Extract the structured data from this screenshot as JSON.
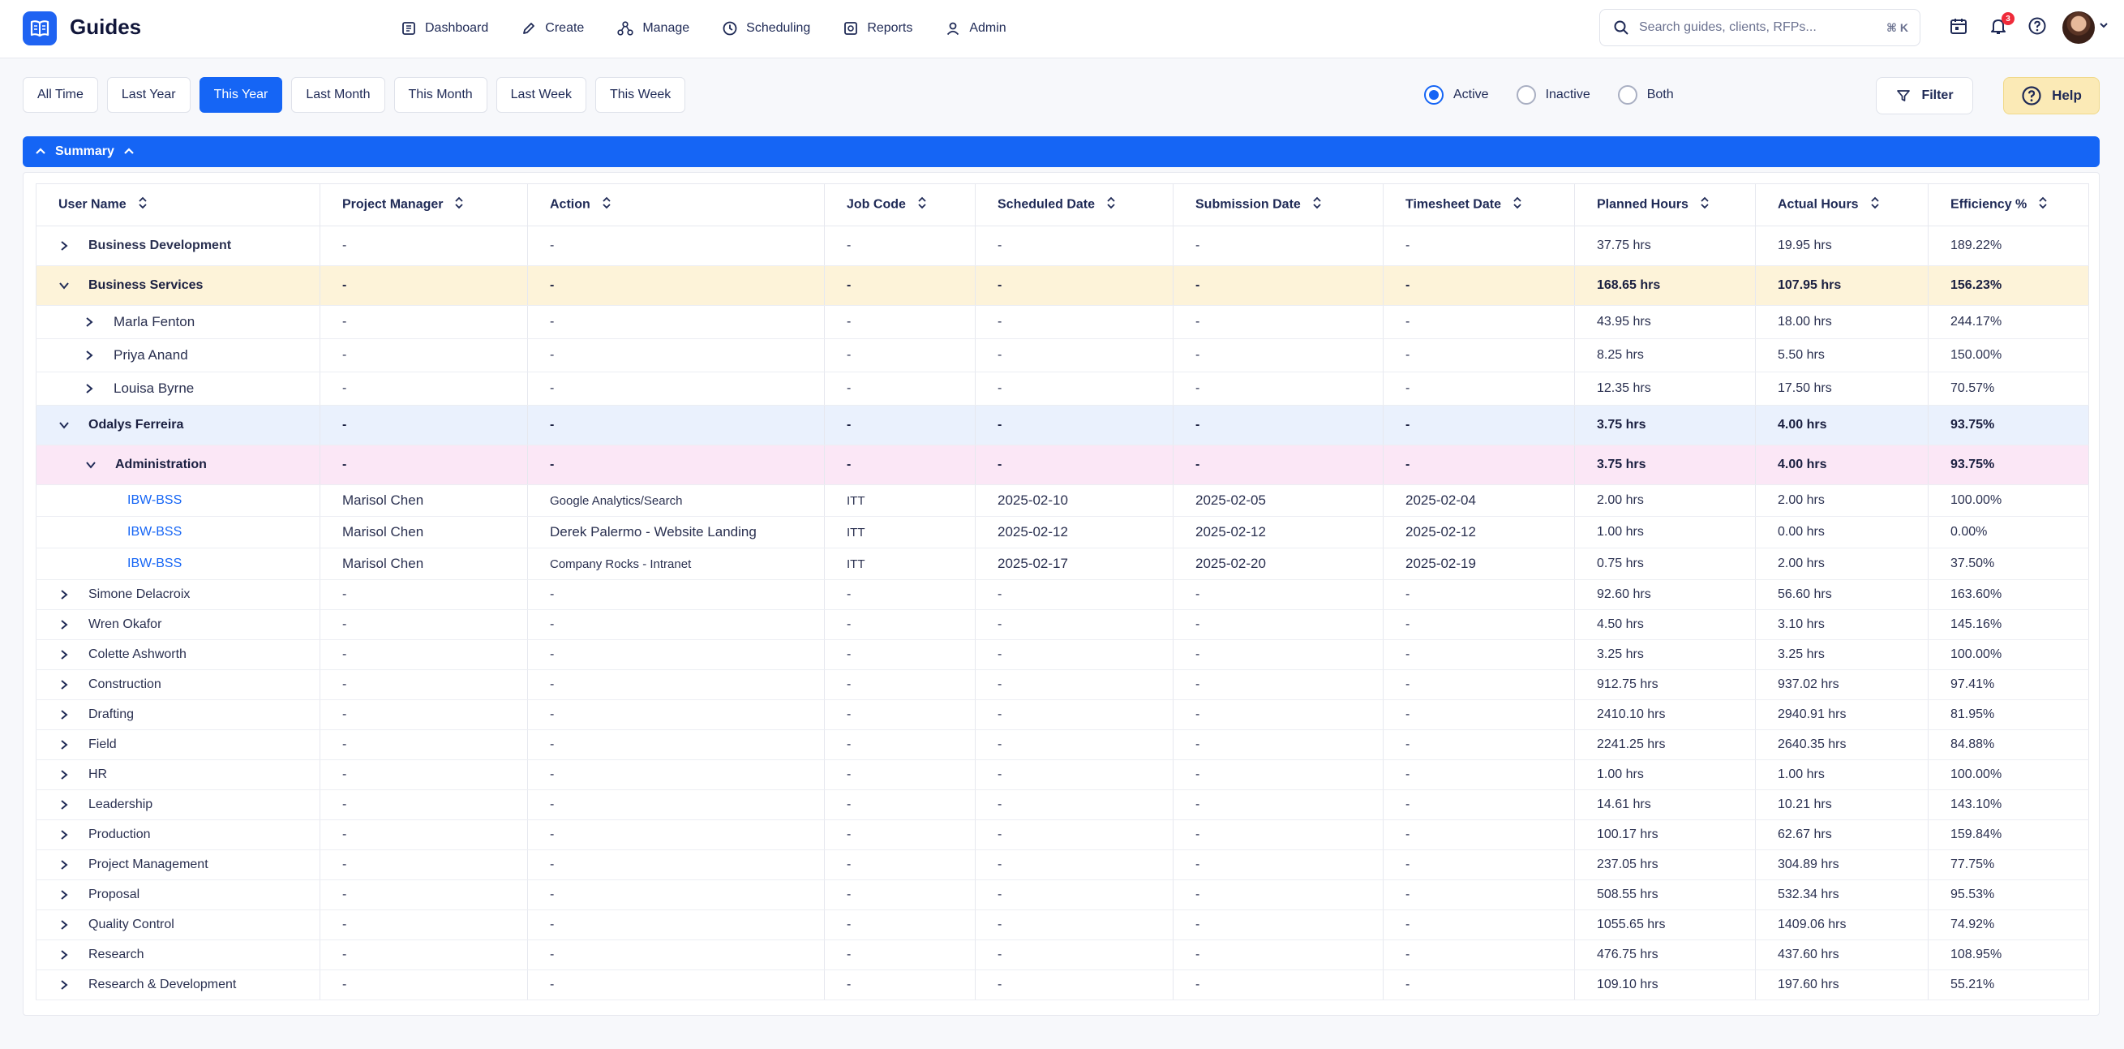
{
  "app": {
    "brand": "Guides"
  },
  "nav": [
    {
      "label": "Dashboard",
      "icon": "dashboard-icon"
    },
    {
      "label": "Create",
      "icon": "pencil-icon"
    },
    {
      "label": "Manage",
      "icon": "manage-icon"
    },
    {
      "label": "Scheduling",
      "icon": "clock-icon"
    },
    {
      "label": "Reports",
      "icon": "reports-icon"
    },
    {
      "label": "Admin",
      "icon": "user-icon"
    }
  ],
  "search": {
    "placeholder": "Search guides, clients, RFPs...",
    "shortcut": "⌘ K"
  },
  "notifications": {
    "count": "3"
  },
  "periods": [
    "All Time",
    "Last Year",
    "This Year",
    "Last Month",
    "This Month",
    "Last Week",
    "This Week"
  ],
  "selected_period": "This Year",
  "status_filter": {
    "options": [
      "Active",
      "Inactive",
      "Both"
    ],
    "selected": "Active"
  },
  "buttons": {
    "filter": "Filter",
    "help": "Help"
  },
  "summary": {
    "label": "Summary"
  },
  "table": {
    "columns": [
      "User Name",
      "Project Manager",
      "Action",
      "Job Code",
      "Scheduled Date",
      "Submission Date",
      "Timesheet Date",
      "Planned Hours",
      "Actual Hours",
      "Efficiency %"
    ],
    "rows": [
      {
        "name": "Business Development",
        "level": 0,
        "expanded": false,
        "kind": "group",
        "pm": "-",
        "action": "-",
        "job": "-",
        "sched": "-",
        "sub": "-",
        "ts": "-",
        "planned": "37.75 hrs",
        "actual": "19.95 hrs",
        "eff": "189.22%"
      },
      {
        "name": "Business Services",
        "level": 0,
        "expanded": true,
        "kind": "group",
        "bg": "yellow",
        "bold": true,
        "pm": "-",
        "action": "-",
        "job": "-",
        "sched": "-",
        "sub": "-",
        "ts": "-",
        "planned": "168.65 hrs",
        "actual": "107.95 hrs",
        "eff": "156.23%"
      },
      {
        "name": "Marla Fenton",
        "level": 1,
        "expanded": false,
        "kind": "sub",
        "pm": "-",
        "action": "-",
        "job": "-",
        "sched": "-",
        "sub": "-",
        "ts": "-",
        "planned": "43.95 hrs",
        "actual": "18.00 hrs",
        "eff": "244.17%"
      },
      {
        "name": "Priya Anand",
        "level": 1,
        "expanded": false,
        "kind": "sub",
        "pm": "-",
        "action": "-",
        "job": "-",
        "sched": "-",
        "sub": "-",
        "ts": "-",
        "planned": "8.25 hrs",
        "actual": "5.50 hrs",
        "eff": "150.00%"
      },
      {
        "name": "Louisa Byrne",
        "level": 1,
        "expanded": false,
        "kind": "sub",
        "pm": "-",
        "action": "-",
        "job": "-",
        "sched": "-",
        "sub": "-",
        "ts": "-",
        "planned": "12.35 hrs",
        "actual": "17.50 hrs",
        "eff": "70.57%"
      },
      {
        "name": "Odalys Ferreira",
        "level": 0,
        "expanded": true,
        "kind": "group",
        "bg": "blue",
        "bold": true,
        "pm": "-",
        "action": "-",
        "job": "-",
        "sched": "-",
        "sub": "-",
        "ts": "-",
        "planned": "3.75 hrs",
        "actual": "4.00 hrs",
        "eff": "93.75%"
      },
      {
        "name": "Administration",
        "level": 2,
        "expanded": true,
        "kind": "group",
        "bg": "pink",
        "bold": true,
        "pm": "-",
        "action": "-",
        "job": "-",
        "sched": "-",
        "sub": "-",
        "ts": "-",
        "planned": "3.75 hrs",
        "actual": "4.00 hrs",
        "eff": "93.75%"
      },
      {
        "name": "IBW-BSS",
        "level": 3,
        "kind": "detail",
        "link": true,
        "pm": "Marisol Chen",
        "action": "Google Analytics/Search",
        "job": "ITT",
        "sched": "2025-02-10",
        "sub": "2025-02-05",
        "ts": "2025-02-04",
        "planned": "2.00 hrs",
        "actual": "2.00 hrs",
        "eff": "100.00%"
      },
      {
        "name": "IBW-BSS",
        "level": 3,
        "kind": "detail",
        "link": true,
        "pm": "Marisol Chen",
        "action": "Derek Palermo - Website Landing",
        "job": "ITT",
        "sched": "2025-02-12",
        "sub": "2025-02-12",
        "ts": "2025-02-12",
        "planned": "1.00 hrs",
        "actual": "0.00 hrs",
        "eff": "0.00%"
      },
      {
        "name": "IBW-BSS",
        "level": 3,
        "kind": "detail",
        "link": true,
        "pm": "Marisol Chen",
        "action": "Company Rocks - Intranet",
        "job": "ITT",
        "sched": "2025-02-17",
        "sub": "2025-02-20",
        "ts": "2025-02-19",
        "planned": "0.75 hrs",
        "actual": "2.00 hrs",
        "eff": "37.50%"
      },
      {
        "name": "Simone Delacroix",
        "level": 0,
        "expanded": false,
        "kind": "plain",
        "pm": "-",
        "action": "-",
        "job": "-",
        "sched": "-",
        "sub": "-",
        "ts": "-",
        "planned": "92.60 hrs",
        "actual": "56.60 hrs",
        "eff": "163.60%"
      },
      {
        "name": "Wren Okafor",
        "level": 0,
        "expanded": false,
        "kind": "plain",
        "pm": "-",
        "action": "-",
        "job": "-",
        "sched": "-",
        "sub": "-",
        "ts": "-",
        "planned": "4.50 hrs",
        "actual": "3.10 hrs",
        "eff": "145.16%"
      },
      {
        "name": "Colette Ashworth",
        "level": 0,
        "expanded": false,
        "kind": "plain",
        "pm": "-",
        "action": "-",
        "job": "-",
        "sched": "-",
        "sub": "-",
        "ts": "-",
        "planned": "3.25 hrs",
        "actual": "3.25 hrs",
        "eff": "100.00%"
      },
      {
        "name": "Construction",
        "level": 0,
        "expanded": false,
        "kind": "plain",
        "pm": "-",
        "action": "-",
        "job": "-",
        "sched": "-",
        "sub": "-",
        "ts": "-",
        "planned": "912.75 hrs",
        "actual": "937.02 hrs",
        "eff": "97.41%"
      },
      {
        "name": "Drafting",
        "level": 0,
        "expanded": false,
        "kind": "plain",
        "pm": "-",
        "action": "-",
        "job": "-",
        "sched": "-",
        "sub": "-",
        "ts": "-",
        "planned": "2410.10 hrs",
        "actual": "2940.91 hrs",
        "eff": "81.95%"
      },
      {
        "name": "Field",
        "level": 0,
        "expanded": false,
        "kind": "plain",
        "pm": "-",
        "action": "-",
        "job": "-",
        "sched": "-",
        "sub": "-",
        "ts": "-",
        "planned": "2241.25 hrs",
        "actual": "2640.35 hrs",
        "eff": "84.88%"
      },
      {
        "name": "HR",
        "level": 0,
        "expanded": false,
        "kind": "plain",
        "pm": "-",
        "action": "-",
        "job": "-",
        "sched": "-",
        "sub": "-",
        "ts": "-",
        "planned": "1.00 hrs",
        "actual": "1.00 hrs",
        "eff": "100.00%"
      },
      {
        "name": "Leadership",
        "level": 0,
        "expanded": false,
        "kind": "plain",
        "pm": "-",
        "action": "-",
        "job": "-",
        "sched": "-",
        "sub": "-",
        "ts": "-",
        "planned": "14.61 hrs",
        "actual": "10.21 hrs",
        "eff": "143.10%"
      },
      {
        "name": "Production",
        "level": 0,
        "expanded": false,
        "kind": "plain",
        "pm": "-",
        "action": "-",
        "job": "-",
        "sched": "-",
        "sub": "-",
        "ts": "-",
        "planned": "100.17 hrs",
        "actual": "62.67 hrs",
        "eff": "159.84%"
      },
      {
        "name": "Project Management",
        "level": 0,
        "expanded": false,
        "kind": "plain",
        "pm": "-",
        "action": "-",
        "job": "-",
        "sched": "-",
        "sub": "-",
        "ts": "-",
        "planned": "237.05 hrs",
        "actual": "304.89 hrs",
        "eff": "77.75%"
      },
      {
        "name": "Proposal",
        "level": 0,
        "expanded": false,
        "kind": "plain",
        "pm": "-",
        "action": "-",
        "job": "-",
        "sched": "-",
        "sub": "-",
        "ts": "-",
        "planned": "508.55 hrs",
        "actual": "532.34 hrs",
        "eff": "95.53%"
      },
      {
        "name": "Quality Control",
        "level": 0,
        "expanded": false,
        "kind": "plain",
        "pm": "-",
        "action": "-",
        "job": "-",
        "sched": "-",
        "sub": "-",
        "ts": "-",
        "planned": "1055.65 hrs",
        "actual": "1409.06 hrs",
        "eff": "74.92%"
      },
      {
        "name": "Research",
        "level": 0,
        "expanded": false,
        "kind": "plain",
        "pm": "-",
        "action": "-",
        "job": "-",
        "sched": "-",
        "sub": "-",
        "ts": "-",
        "planned": "476.75 hrs",
        "actual": "437.60 hrs",
        "eff": "108.95%"
      },
      {
        "name": "Research & Development",
        "level": 0,
        "expanded": false,
        "kind": "plain",
        "pm": "-",
        "action": "-",
        "job": "-",
        "sched": "-",
        "sub": "-",
        "ts": "-",
        "planned": "109.10 hrs",
        "actual": "197.60 hrs",
        "eff": "55.21%"
      }
    ]
  },
  "colors": {
    "accent": "#1565f5",
    "help": "#fbeab6",
    "row_yellow": "#fdf3d9",
    "row_blue": "#eaf1fd",
    "row_pink": "#fbe7f6",
    "badge": "#ef2b3a"
  }
}
